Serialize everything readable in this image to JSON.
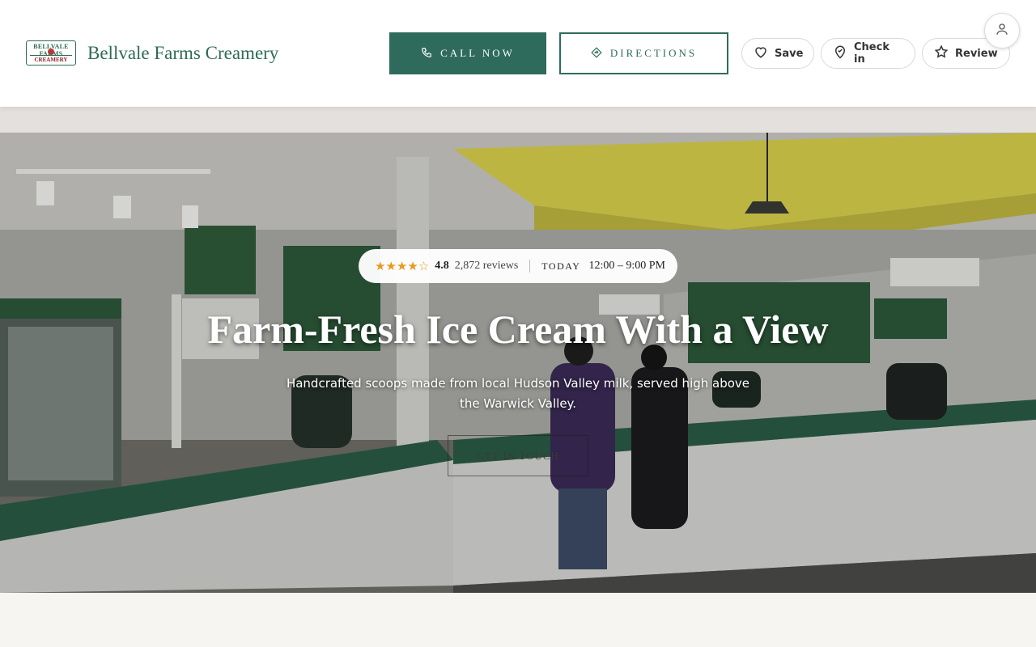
{
  "brand": {
    "name": "Bellvale Farms Creamery",
    "logo_top": "BELLVALE FARMS",
    "logo_bottom": "CREAMERY"
  },
  "actions": {
    "call_label": "CALL NOW",
    "directions_label": "DIRECTIONS",
    "save_label": "Save",
    "checkin_label": "Check in",
    "review_label": "Review"
  },
  "hero": {
    "stars": "★★★★☆",
    "rating": "4.8",
    "reviews": "2,872 reviews",
    "today_label": "TODAY",
    "hours": "12:00 – 9:00 PM",
    "title": "Farm-Fresh Ice Cream With a View",
    "subtitle": "Handcrafted scoops made from local Hudson Valley milk, served high above the Warwick Valley.",
    "cta_label": "GET IN TOUCH"
  },
  "colors": {
    "brand_green": "#2f6b5c",
    "star": "#e89a1c",
    "header_bg": "#ffffff",
    "band": "#e4e0dd"
  },
  "icons": [
    "phone-icon",
    "directions-icon",
    "heart-icon",
    "checkin-pin-icon",
    "star-icon",
    "user-icon"
  ]
}
